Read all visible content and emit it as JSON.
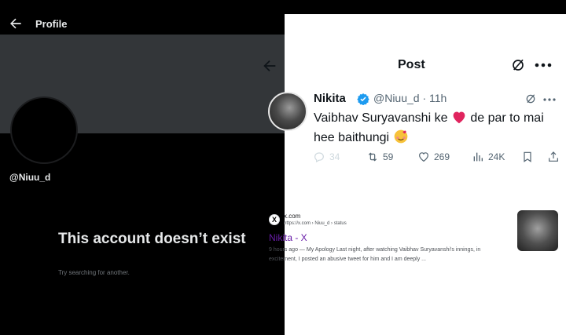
{
  "left_panel": {
    "title": "Profile",
    "handle": "@Niuu_d",
    "message": "This account doesn’t exist",
    "sub_message": "Try searching for another."
  },
  "post_panel": {
    "header_title": "Post",
    "author_name": "Nikita",
    "author_meta": "@Niuu_d · 11h",
    "text_part1": "Vaibhav Suryavanshi ke ",
    "text_part2": " de par to mai hee baithungi ",
    "reply_count": "34",
    "repost_count": "59",
    "like_count": "269",
    "view_count": "24K"
  },
  "search_result": {
    "site_name": "x.com",
    "url": "https://x.com › Niuu_d › status",
    "title": "Nikita - X",
    "snippet": "9 hours ago — My Apology Last night, after watching Vaibhav Suryavanshi's innings, in excitement, I posted an abusive tweet for him and I am deeply ..."
  },
  "icons": {
    "favicon": "X"
  },
  "colors": {
    "verified_blue": "#1d9bf0",
    "link_visited": "#681da8",
    "heart": "#e0245e"
  }
}
